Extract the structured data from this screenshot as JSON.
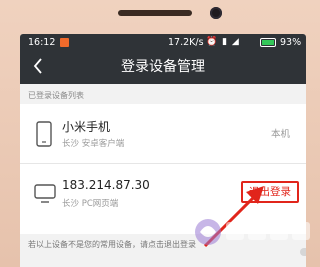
{
  "status_bar": {
    "time": "16:12",
    "speed": "17.2K/s",
    "icons": "⏰ ▮ ◢",
    "battery": "93%"
  },
  "header": {
    "back_icon": "chevron-left-icon",
    "title": "登录设备管理"
  },
  "section_label": "已登录设备列表",
  "devices": [
    {
      "icon": "phone-icon",
      "name": "小米手机",
      "detail": "长沙  安卓客户端",
      "tag": "本机"
    },
    {
      "icon": "monitor-icon",
      "name": "183.214.87.30",
      "detail": "长沙  PC网页端",
      "action": "退出登录"
    }
  ],
  "footer_note": "若以上设备不是您的常用设备，请点击退出登录",
  "colors": {
    "header_bg": "#2f3337",
    "accent": "#e1251b",
    "frame": "#e9c7b1"
  }
}
